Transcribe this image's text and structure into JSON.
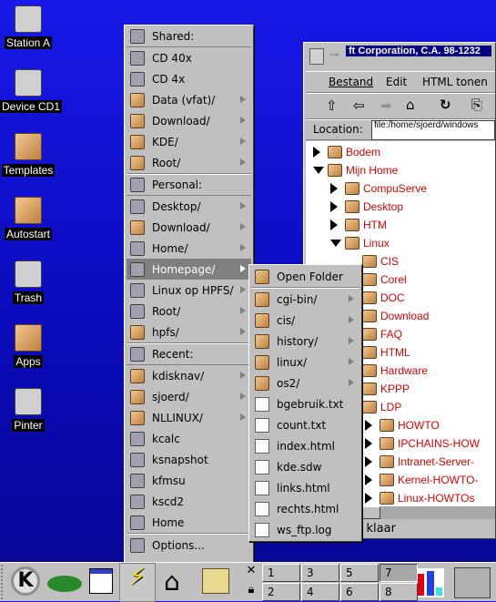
{
  "desktop": {
    "icons": [
      {
        "label": "Station A",
        "icon": "floppy-icon"
      },
      {
        "label": "Device CD1",
        "icon": "cdrom-icon"
      },
      {
        "label": "Templates",
        "icon": "folder-icon"
      },
      {
        "label": "Autostart",
        "icon": "folder-icon"
      },
      {
        "label": "Trash",
        "icon": "trash-icon"
      },
      {
        "label": "Apps",
        "icon": "folder-icon"
      },
      {
        "label": "Pinter",
        "icon": "printer-icon"
      }
    ]
  },
  "menu": {
    "items": [
      {
        "label": "Shared:",
        "type": "header",
        "icon": "shared-icon"
      },
      {
        "label": "CD 40x",
        "icon": "cdrom-icon"
      },
      {
        "label": "CD 4x",
        "icon": "cdrom-icon"
      },
      {
        "label": "Data (vfat)/",
        "icon": "folder-icon",
        "sub": true
      },
      {
        "label": "Download/",
        "icon": "folder-icon",
        "sub": true
      },
      {
        "label": "KDE/",
        "icon": "folder-icon",
        "sub": true
      },
      {
        "label": "Root/",
        "icon": "folder-icon",
        "sub": true
      },
      {
        "label": "Personal:",
        "type": "header",
        "icon": "person-icon"
      },
      {
        "label": "Desktop/",
        "icon": "desktop-icon",
        "sub": true
      },
      {
        "label": "Download/",
        "icon": "folder-icon",
        "sub": true
      },
      {
        "label": "Home/",
        "icon": "home-icon",
        "sub": true
      },
      {
        "label": "Homepage/",
        "icon": "globe-icon",
        "sub": true,
        "highlighted": true
      },
      {
        "label": "Linux op HPFS/",
        "icon": "penguin-icon",
        "sub": true
      },
      {
        "label": "Root/",
        "icon": "home-icon",
        "sub": true
      },
      {
        "label": "hpfs/",
        "icon": "folder-icon",
        "sub": true
      },
      {
        "label": "Recent:",
        "type": "header",
        "icon": "recent-icon"
      },
      {
        "label": "kdisknav/",
        "icon": "folder-icon",
        "sub": true
      },
      {
        "label": "sjoerd/",
        "icon": "folder-icon",
        "sub": true
      },
      {
        "label": "NLLINUX/",
        "icon": "folder-icon",
        "sub": true
      },
      {
        "label": "kcalc",
        "icon": "calculator-icon"
      },
      {
        "label": "ksnapshot",
        "icon": "camera-icon"
      },
      {
        "label": "kfmsu",
        "icon": "app-icon"
      },
      {
        "label": "kscd2",
        "icon": "cd-player-icon"
      },
      {
        "label": "Home",
        "icon": "home-icon"
      },
      {
        "label": "Options...",
        "icon": "options-icon",
        "type": "footer"
      }
    ]
  },
  "submenu": {
    "items": [
      {
        "label": "Open Folder",
        "icon": "folder-open-icon"
      },
      {
        "label": "cgi-bin/",
        "icon": "folder-icon",
        "sub": true
      },
      {
        "label": "cis/",
        "icon": "folder-icon",
        "sub": true
      },
      {
        "label": "history/",
        "icon": "folder-icon",
        "sub": true
      },
      {
        "label": "linux/",
        "icon": "folder-icon",
        "sub": true
      },
      {
        "label": "os2/",
        "icon": "folder-icon",
        "sub": true
      },
      {
        "label": "bgebruik.txt",
        "icon": "file-icon"
      },
      {
        "label": "count.txt",
        "icon": "file-icon"
      },
      {
        "label": "index.html",
        "icon": "file-icon"
      },
      {
        "label": "kde.sdw",
        "icon": "file-icon"
      },
      {
        "label": "links.html",
        "icon": "file-icon"
      },
      {
        "label": "rechts.html",
        "icon": "file-icon"
      },
      {
        "label": "ws_ftp.log",
        "icon": "file-icon"
      }
    ]
  },
  "browser": {
    "title": "ft Corporation, C.A. 98-1232",
    "menubar": [
      "Bestand",
      "Edit",
      "HTML tonen"
    ],
    "location_label": "Location:",
    "location_value": "file:/home/sjoerd/windows",
    "status": ": klaar",
    "tree": [
      {
        "label": "Bodem",
        "depth": 0,
        "state": "collapsed"
      },
      {
        "label": "Mijn Home",
        "depth": 0,
        "state": "expanded",
        "icon": "home-icon"
      },
      {
        "label": "CompuServe",
        "depth": 1,
        "state": "collapsed"
      },
      {
        "label": "Desktop",
        "depth": 1,
        "state": "collapsed"
      },
      {
        "label": "HTM",
        "depth": 1,
        "state": "collapsed"
      },
      {
        "label": "Linux",
        "depth": 1,
        "state": "expanded"
      },
      {
        "label": "CIS",
        "depth": 2
      },
      {
        "label": "Corel",
        "depth": 2
      },
      {
        "label": "DOC",
        "depth": 2
      },
      {
        "label": "Download",
        "depth": 2
      },
      {
        "label": "FAQ",
        "depth": 2
      },
      {
        "label": "HTML",
        "depth": 2
      },
      {
        "label": "Hardware",
        "depth": 2
      },
      {
        "label": "KPPP",
        "depth": 2
      },
      {
        "label": "LDP",
        "depth": 2
      },
      {
        "label": "HOWTO",
        "depth": 3,
        "state": "collapsed"
      },
      {
        "label": "IPCHAINS-HOW",
        "depth": 3,
        "state": "collapsed"
      },
      {
        "label": "Intranet-Server-",
        "depth": 3,
        "state": "collapsed"
      },
      {
        "label": "Kernel-HOWTO-",
        "depth": 3,
        "state": "collapsed"
      },
      {
        "label": "Linux-HOWTOs",
        "depth": 3,
        "state": "collapsed"
      }
    ]
  },
  "taskbar": {
    "desktops": [
      "1",
      "2",
      "3",
      "4",
      "5",
      "6",
      "7",
      "8"
    ],
    "active_desktop": "7"
  }
}
